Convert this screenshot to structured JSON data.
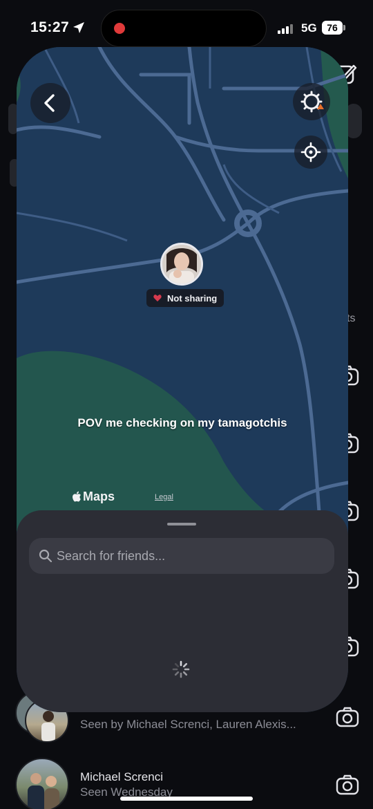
{
  "status_bar": {
    "time": "15:27",
    "network": "5G",
    "battery": "76"
  },
  "background": {
    "partial_text": "ts",
    "rows": [
      {
        "name": "",
        "subtitle": "Seen by Michael Screnci, Lauren Alexis..."
      },
      {
        "name": "Michael Screnci",
        "subtitle": "Seen Wednesday"
      }
    ]
  },
  "map": {
    "friend_status": "Not sharing",
    "caption": "POV me checking on my tamagotchis",
    "maps_brand": "Maps",
    "legal": "Legal",
    "colors": {
      "land": "#1e3a5a",
      "park": "#23564e",
      "road": "#4c6a93"
    }
  },
  "sheet": {
    "search_placeholder": "Search for friends..."
  },
  "icons": [
    "location-arrow-icon",
    "back-chevron-icon",
    "settings-gear-icon",
    "recenter-target-icon",
    "search-icon",
    "loading-spinner-icon",
    "camera-icon",
    "compose-icon",
    "apple-logo-icon"
  ]
}
